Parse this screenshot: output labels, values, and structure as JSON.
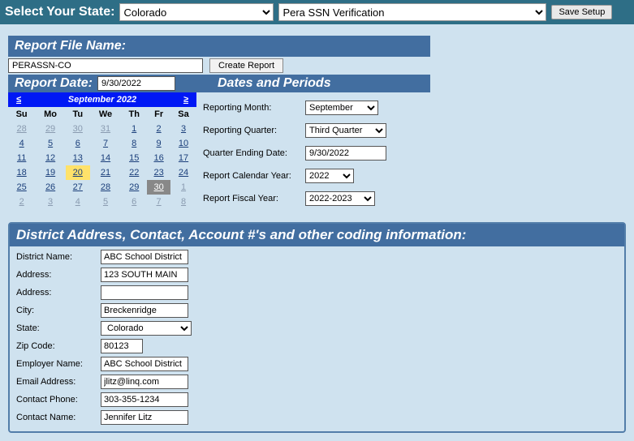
{
  "topbar": {
    "label": "Select Your State:",
    "state": "Colorado",
    "report": "Pera SSN Verification",
    "save_label": "Save Setup"
  },
  "filename": {
    "header": "Report File Name:",
    "value": "PERASSN-CO",
    "create_btn": "Create Report"
  },
  "report_date": {
    "header": "Report Date:",
    "value": "9/30/2022"
  },
  "dates_header": "Dates and Periods",
  "calendar": {
    "title": "September 2022",
    "prev": "≤",
    "next": "≥",
    "dow": [
      "Su",
      "Mo",
      "Tu",
      "We",
      "Th",
      "Fr",
      "Sa"
    ],
    "weeks": [
      [
        {
          "d": "28",
          "o": 1
        },
        {
          "d": "29",
          "o": 1
        },
        {
          "d": "30",
          "o": 1
        },
        {
          "d": "31",
          "o": 1
        },
        {
          "d": "1"
        },
        {
          "d": "2"
        },
        {
          "d": "3"
        }
      ],
      [
        {
          "d": "4"
        },
        {
          "d": "5"
        },
        {
          "d": "6"
        },
        {
          "d": "7"
        },
        {
          "d": "8"
        },
        {
          "d": "9"
        },
        {
          "d": "10"
        }
      ],
      [
        {
          "d": "11"
        },
        {
          "d": "12"
        },
        {
          "d": "13"
        },
        {
          "d": "14"
        },
        {
          "d": "15"
        },
        {
          "d": "16"
        },
        {
          "d": "17"
        }
      ],
      [
        {
          "d": "18"
        },
        {
          "d": "19"
        },
        {
          "d": "20",
          "sel": 1
        },
        {
          "d": "21"
        },
        {
          "d": "22"
        },
        {
          "d": "23"
        },
        {
          "d": "24"
        }
      ],
      [
        {
          "d": "25"
        },
        {
          "d": "26"
        },
        {
          "d": "27"
        },
        {
          "d": "28"
        },
        {
          "d": "29"
        },
        {
          "d": "30",
          "today": 1
        },
        {
          "d": "1",
          "o": 1
        }
      ],
      [
        {
          "d": "2",
          "o": 1
        },
        {
          "d": "3",
          "o": 1
        },
        {
          "d": "4",
          "o": 1
        },
        {
          "d": "5",
          "o": 1
        },
        {
          "d": "6",
          "o": 1
        },
        {
          "d": "7",
          "o": 1
        },
        {
          "d": "8",
          "o": 1
        }
      ]
    ]
  },
  "periods": {
    "month_label": "Reporting Month:",
    "month": "September",
    "quarter_label": "Reporting Quarter:",
    "quarter": "Third Quarter",
    "qend_label": "Quarter Ending Date:",
    "qend": "9/30/2022",
    "calyear_label": "Report Calendar Year:",
    "calyear": "2022",
    "fisyear_label": "Report Fiscal Year:",
    "fisyear": "2022-2023"
  },
  "district": {
    "header": "District Address, Contact, Account #'s and other coding information:",
    "fields": {
      "district_name_label": "District Name:",
      "district_name": "ABC School District",
      "address1_label": "Address:",
      "address1": "123 SOUTH MAIN",
      "address2_label": "Address:",
      "address2": "",
      "city_label": "City:",
      "city": "Breckenridge",
      "state_label": "State:",
      "state": "Colorado",
      "zip_label": "Zip Code:",
      "zip": "80123",
      "employer_label": "Employer Name:",
      "employer": "ABC School District",
      "email_label": "Email Address:",
      "email": "jlitz@linq.com",
      "phone_label": "Contact Phone:",
      "phone": "303-355-1234",
      "contact_label": "Contact Name:",
      "contact": "Jennifer Litz"
    }
  }
}
